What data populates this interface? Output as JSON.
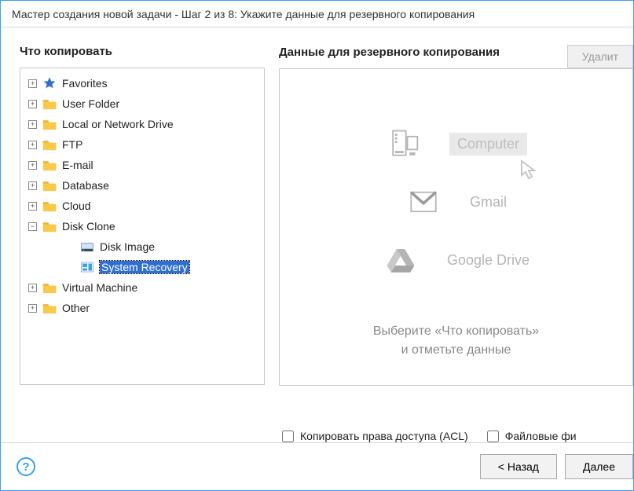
{
  "titlebar": "Мастер создания новой задачи - Шаг 2 из 8: Укажите данные для резервного копирования",
  "left": {
    "header": "Что копировать",
    "nodes": [
      {
        "label": "Favorites",
        "icon": "star",
        "level": 0,
        "expander": "plus"
      },
      {
        "label": "User Folder",
        "icon": "folder",
        "level": 0,
        "expander": "plus"
      },
      {
        "label": "Local or Network Drive",
        "icon": "folder",
        "level": 0,
        "expander": "plus"
      },
      {
        "label": "FTP",
        "icon": "folder",
        "level": 0,
        "expander": "plus"
      },
      {
        "label": "E-mail",
        "icon": "folder",
        "level": 0,
        "expander": "plus"
      },
      {
        "label": "Database",
        "icon": "folder",
        "level": 0,
        "expander": "plus"
      },
      {
        "label": "Cloud",
        "icon": "folder",
        "level": 0,
        "expander": "plus"
      },
      {
        "label": "Disk Clone",
        "icon": "folder",
        "level": 0,
        "expander": "minus"
      },
      {
        "label": "Disk Image",
        "icon": "disk",
        "level": 1,
        "expander": "none"
      },
      {
        "label": "System Recovery",
        "icon": "sys",
        "level": 1,
        "expander": "none",
        "selected": true
      },
      {
        "label": "Virtual Machine",
        "icon": "folder",
        "level": 0,
        "expander": "plus"
      },
      {
        "label": "Other",
        "icon": "folder",
        "level": 0,
        "expander": "plus"
      }
    ]
  },
  "right": {
    "header": "Данные для резервного копирования",
    "delete_label": "Удалит",
    "items": [
      {
        "label": "Computer",
        "icon": "computer",
        "boxed": true
      },
      {
        "label": "Gmail",
        "icon": "gmail",
        "boxed": false
      },
      {
        "label": "Google Drive",
        "icon": "gdrive",
        "boxed": false
      }
    ],
    "hint_line1": "Выберите «Что копировать»",
    "hint_line2": "и отметьте данные"
  },
  "checks": {
    "acl": "Копировать права доступа (ACL)",
    "filters": "Файловые фи"
  },
  "footer": {
    "back": "< Назад",
    "next": "Далее"
  }
}
